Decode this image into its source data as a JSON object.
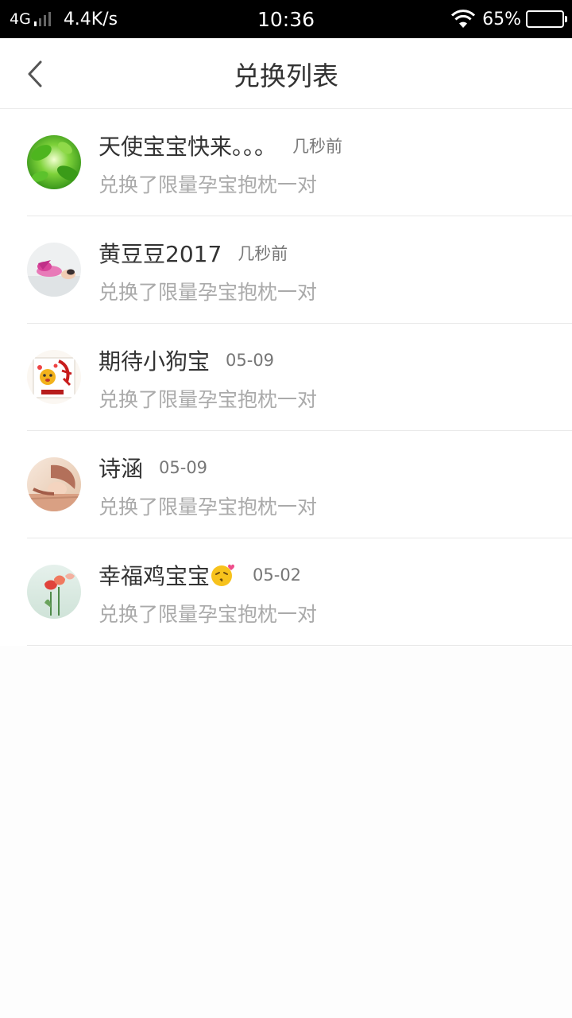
{
  "status_bar": {
    "network_type": "4G",
    "speed": "4.4K/s",
    "time": "10:36",
    "battery_percent": "65%",
    "battery_level": 0.65,
    "icons": [
      "signal-icon",
      "wifi-icon",
      "battery-icon"
    ]
  },
  "header": {
    "title": "兑换列表",
    "back_icon": "chevron-left-icon"
  },
  "exchanges": [
    {
      "name": "天使宝宝快来。。。",
      "time": "几秒前",
      "desc": "兑换了限量孕宝抱枕一对",
      "avatar": "green-leaves-avatar"
    },
    {
      "name": "黄豆豆2017",
      "time": "几秒前",
      "desc": "兑换了限量孕宝抱枕一对",
      "avatar": "baby-photo-avatar"
    },
    {
      "name": "期待小狗宝",
      "time": "05-09",
      "desc": "兑换了限量孕宝抱枕一对",
      "avatar": "dog-year-avatar"
    },
    {
      "name": "诗涵",
      "time": "05-09",
      "desc": "兑换了限量孕宝抱枕一对",
      "avatar": "sleeping-girl-avatar"
    },
    {
      "name": "幸福鸡宝宝",
      "time": "05-02",
      "desc": "兑换了限量孕宝抱枕一对",
      "avatar": "tulip-avatar",
      "emoji": "kiss-face-icon"
    }
  ],
  "colors": {
    "status_bar_bg": "#000000",
    "page_bg": "#fdfdfd",
    "primary_text": "#333333",
    "secondary_text": "#aaaaaa",
    "divider": "#e8e8e8"
  }
}
